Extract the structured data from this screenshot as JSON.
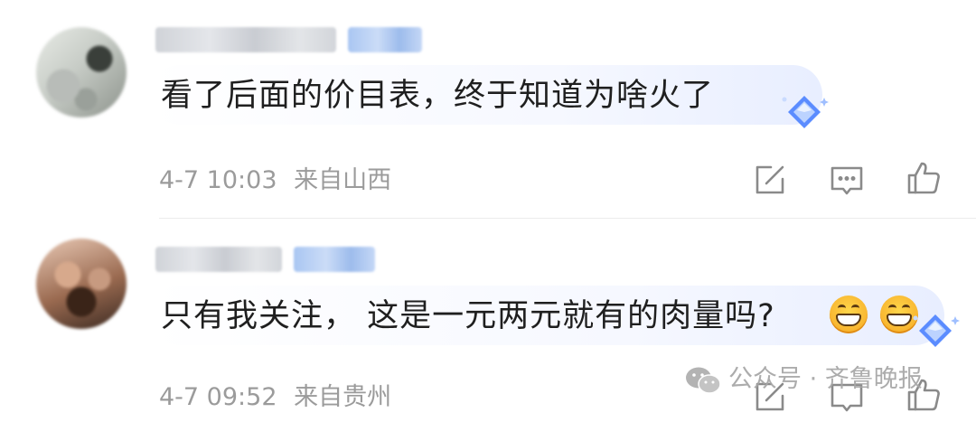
{
  "comments": [
    {
      "text": "看了后面的价目表，终于知道为啥火了",
      "time": "4-7 10:03",
      "location": "来自山西"
    },
    {
      "text": "只有我关注， 这是一元两元就有的肉量吗?",
      "time": "4-7 09:52",
      "location": "来自贵州"
    }
  ],
  "watermark": {
    "text": "公众号 · 齐鲁晚报",
    "icon": "wechat-icon"
  },
  "icons": [
    "share-icon",
    "reply-icon",
    "like-icon",
    "diamond-icon",
    "grin-emoji"
  ],
  "colors": {
    "text": "#1f1f1f",
    "meta": "#9b9b9b",
    "bubble_tint": "#e8eeff",
    "diamond": "#5b8cff"
  }
}
